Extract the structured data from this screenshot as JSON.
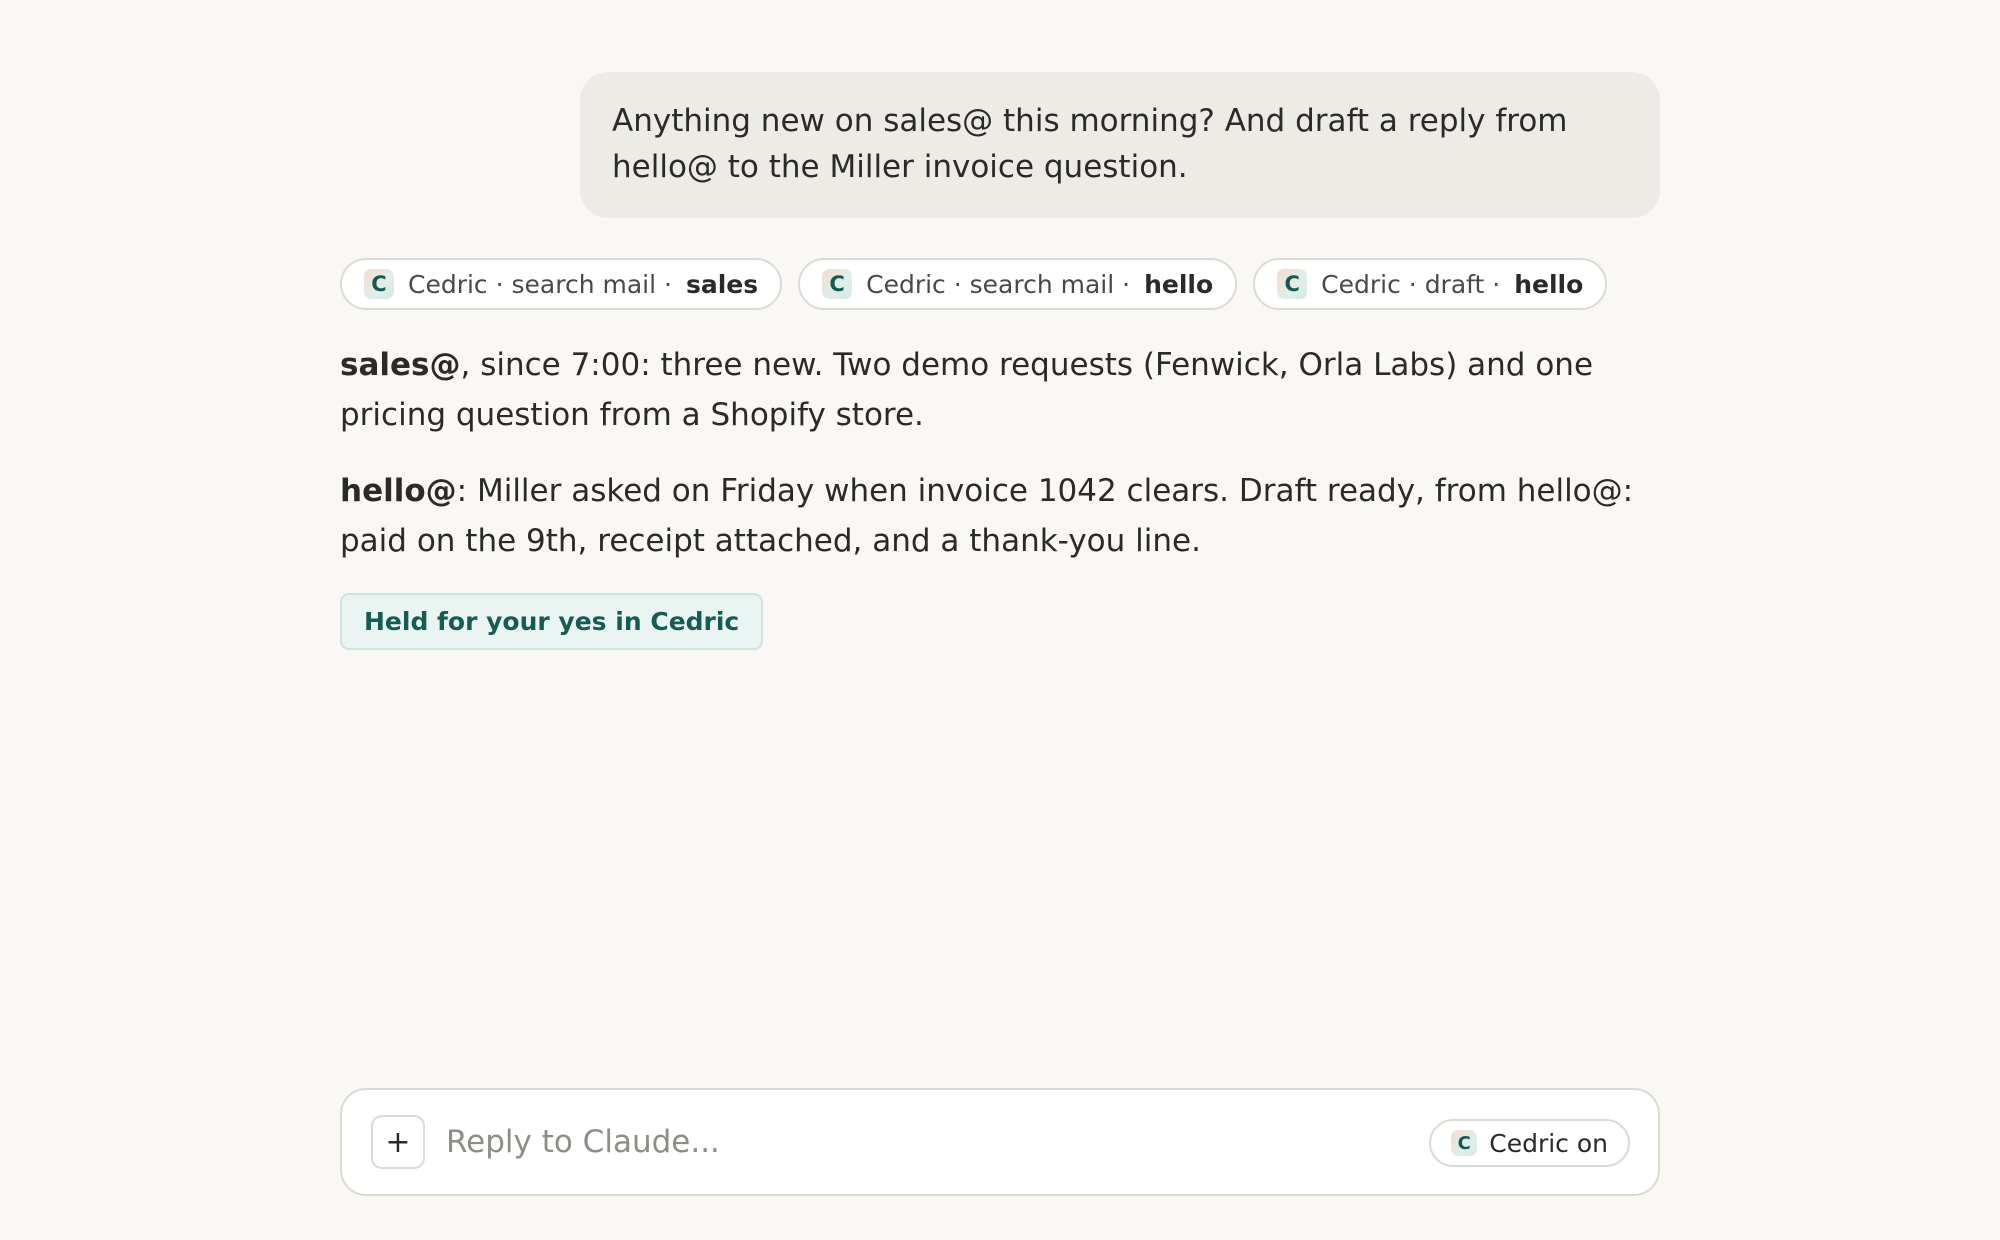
{
  "conversation": {
    "user_message": "Anything new on sales@ this morning? And draft a reply from hello@ to the Miller invoice question.",
    "tool_calls": [
      {
        "logo": "C",
        "label": "Cedric · search mail ·",
        "target": "sales"
      },
      {
        "logo": "C",
        "label": "Cedric · search mail ·",
        "target": "hello"
      },
      {
        "logo": "C",
        "label": "Cedric · draft ·",
        "target": "hello"
      }
    ],
    "response": {
      "para1_bold": "sales@",
      "para1_text": ", since 7:00: three new. Two demo requests (Fenwick, Orla Labs) and one pricing question from a Shopify store.",
      "para2_bold": "hello@",
      "para2_text": ": Miller asked on Friday when invoice 1042 clears. Draft ready, from hello@: paid on the 9th, receipt attached, and a thank-you line."
    },
    "held_badge": "Held for your yes in Cedric"
  },
  "composer": {
    "plus_label": "+",
    "placeholder": "Reply to Claude...",
    "connector_logo": "C",
    "connector_label": "Cedric on"
  },
  "colors": {
    "background": "#f9f8f5",
    "user_bubble": "#ecebe6",
    "badge_bg": "#eaf4f2",
    "badge_text": "#165c52",
    "logo_text": "#155a52"
  }
}
